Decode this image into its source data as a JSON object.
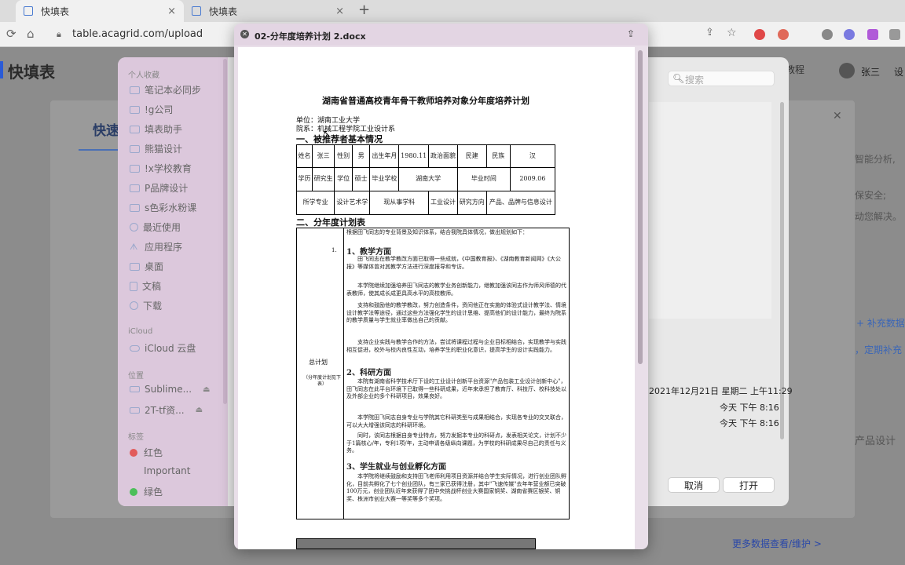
{
  "browser": {
    "tabs": [
      {
        "label": "快填表"
      },
      {
        "label": "快填表"
      }
    ],
    "new_tab": "+",
    "url": "table.acagrid.com/upload",
    "close": "×"
  },
  "app": {
    "title": "快填表",
    "help": "教程",
    "user": "张三",
    "settings": "设",
    "card_title": "快速",
    "side_texts": [
      "智能分析,",
      "保安全;",
      "动您解决。",
      "，定期补充",
      "产品设计"
    ],
    "more_link": "更多数据查看/维护 >"
  },
  "dialog": {
    "sidebar": {
      "favorites_header": "个人收藏",
      "favorites": [
        "笔记本必同步",
        "!g公司",
        "填表助手",
        "熊猫设计",
        "!x学校教育",
        "P品牌设计",
        "s色彩水粉课",
        "最近使用",
        "应用程序",
        "桌面",
        "文稿",
        "下载"
      ],
      "icloud_header": "iCloud",
      "icloud": [
        "iCloud 云盘"
      ],
      "locations_header": "位置",
      "locations": [
        "Sublime...",
        "2T-tf资..."
      ],
      "tags_header": "标签",
      "tags": [
        {
          "label": "红色",
          "color": "#e25b5b"
        },
        {
          "label": "Important",
          "color": ""
        },
        {
          "label": "绿色",
          "color": "#4cbf5a"
        }
      ]
    },
    "search_placeholder": "搜索",
    "add_data": "+ 补充数据",
    "dates": [
      "2021年12月21日 星期二 上午11:29",
      "今天 下午 8:16",
      "今天 下午 8:16"
    ],
    "cancel": "取消",
    "open": "打开"
  },
  "quicklook": {
    "title": "02-分年度培养计划 2.docx",
    "doc": {
      "title": "湖南省普通高校青年骨干教师培养对象分年度培养计划",
      "unit": "单位：湖南工业大学",
      "dept": "院系：机械工程学院工业设计系",
      "sec1": "一、被推荐者基本情况",
      "info_rows": [
        [
          "姓名",
          "张三",
          "性别",
          "男",
          "出生年月",
          "1980.11",
          "政治面貌",
          "民建",
          "民族",
          "汉"
        ],
        [
          "学历",
          "研究生",
          "学位",
          "硕士",
          "毕业学校",
          "湖南大学",
          "毕业时间",
          "2009.06"
        ],
        [
          "所学专业",
          "设计艺术学",
          "现从事学科",
          "工业设计",
          "研究方向",
          "产品、品牌与信息设计"
        ]
      ],
      "sec2": "二、分年度计划表",
      "plan_label": "总计划",
      "plan_sub": "（分年度计划见下表）",
      "intro": "根据田飞同志的专业背景及知识体系，结合我院具体情况，做出规划如下：",
      "list_num": "1.",
      "h1": "1、教学方面",
      "p1a": "田飞同志在教学教改方面已取得一些成就，《中国教育报》、《湖南教育新闻网》《大公报》等媒体曾对其教学方法进行深度报导和专访。",
      "p1b": "本学院继续加强培养田飞同志的教学业务创新能力，继教加强该同志作为师风师德的代表教师，使其成长成更具高水平的高校教师。",
      "p1c": "支持和鼓励他的教学教改，努力创造条件，资间他正在实施的体验式设计教学法、情境设计教学法等途径，通过这些方法强化学生的设计思维、提高他们的设计能力，最终为院系的教学质量与学生就业率做出自己的贡献。",
      "p1d": "支持企业实践与教学合作的方法，尝试将课程过程与企业目标相结合，实现教学与实践相互促进，校外与校内良性互动，培养学生的职业化意识，提高学生的设计实践能力。",
      "h2": "2、科研方面",
      "p2a": "本院有湖南省科学技术厅下设的工业设计创新平台资源\"产品包装工业设计创新中心\"，田飞同志在此平台环境下已取得一些科研成果，近年来承担了教育厅、科技厅、校科技处以及外部企业的多个科研项目，效果良好。",
      "p2b": "本学院田飞同志自身专业与学院其它科研类型与成果相结合，实现各专业的交叉联合，可以大大增强该同志的科研环境。",
      "p2c": "同时，该同志根据自身专业特点，努力发掘本专业的科研点，发表相关论文，计划不少于1篇核心/年，专利1项/年，主动申请各级纵向课题，为学校的科研成果尽自己的责任与义务。",
      "h3": "3、学生就业与创业孵化方面",
      "p3a": "本学院将继续鼓励和支持田飞老师利用项目资源并结合学生实际情况，进行创业团队孵化，目前共孵化了七个创业团队，有三家已获得注册，其中\"飞速传媒\"去年年营业额已突破100万元，创业团队近年来获得了团中央挑战杯创业大赛国家铜奖、湖南省赛区银奖、铜奖、株洲市创业大赛一等奖等多个奖项。"
    }
  }
}
